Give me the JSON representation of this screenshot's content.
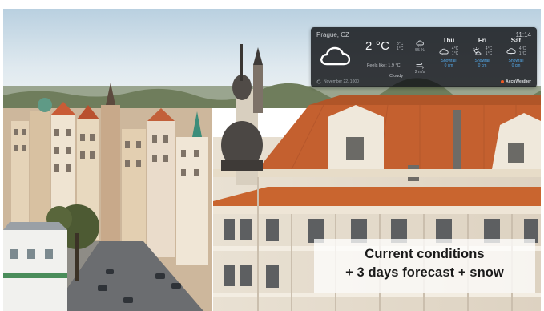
{
  "widget": {
    "city": "Prague, CZ",
    "time": "11:14",
    "current_icon": "cloud-icon",
    "temperature": "2 °C",
    "high": "3°C",
    "low": "1°C",
    "feels_like": "Feels like: 1.9 °C",
    "condition": "Cloudy",
    "humidity": "55 %",
    "wind": "2 m/s",
    "forecast": [
      {
        "day": "Thu",
        "icon": "snowflake-cloud-icon",
        "high": "4°C",
        "low": "1°C",
        "precip": "Snowfall",
        "amount": "0 cm"
      },
      {
        "day": "Fri",
        "icon": "sun-snow-icon",
        "high": "4°C",
        "low": "1°C",
        "precip": "Snowfall",
        "amount": "0 cm"
      },
      {
        "day": "Sat",
        "icon": "cloud-snow-icon",
        "high": "4°C",
        "low": "1°C",
        "precip": "Snowfall",
        "amount": "0 cm"
      }
    ],
    "updated": "November 22, 1000",
    "brand": "AccuWeather",
    "brand_color": "#f15a24"
  },
  "caption": {
    "line1": "Current conditions",
    "line2": "+ 3 days forecast + snow"
  }
}
